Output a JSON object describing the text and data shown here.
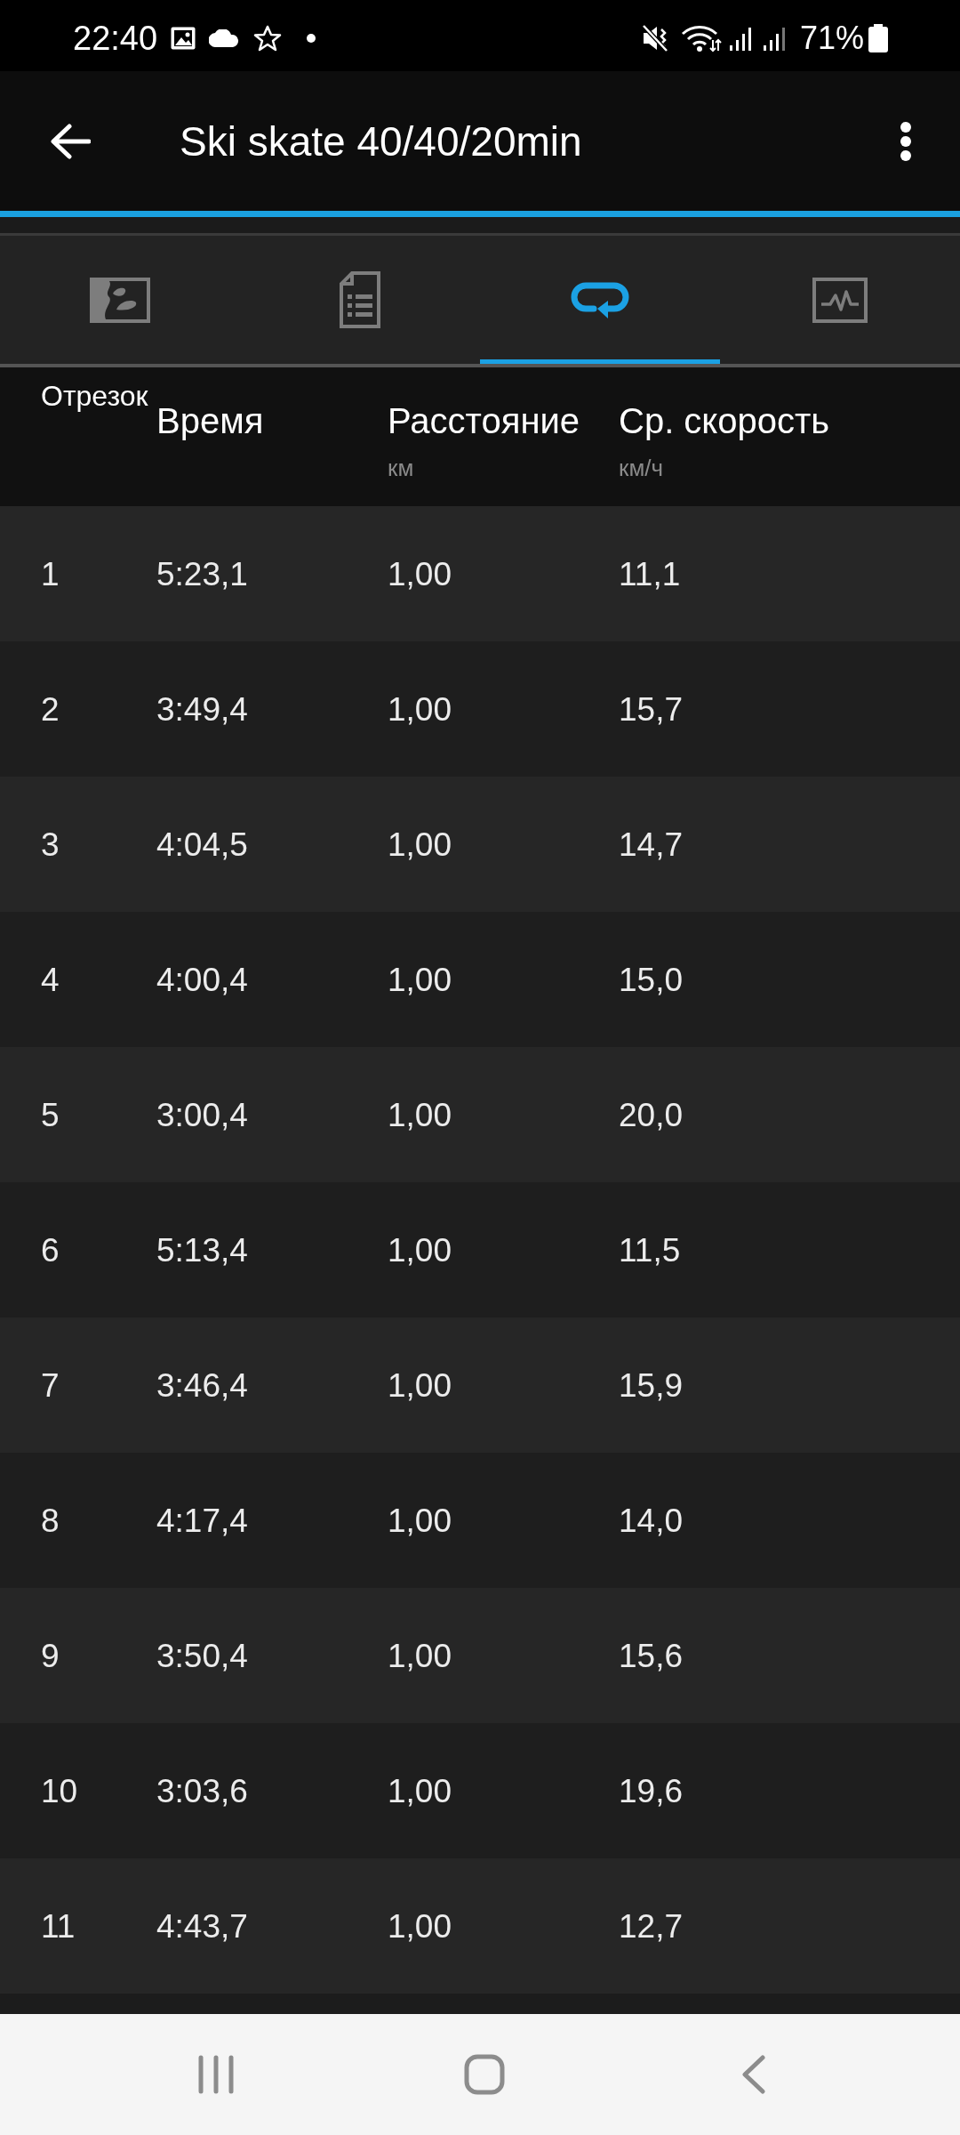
{
  "status_bar": {
    "time": "22:40",
    "battery_percent": "71%"
  },
  "app_bar": {
    "title": "Ski skate 40/40/20min"
  },
  "tabs": [
    {
      "kind": "map",
      "selected": false
    },
    {
      "kind": "details",
      "selected": false
    },
    {
      "kind": "laps",
      "selected": true
    },
    {
      "kind": "charts",
      "selected": false
    }
  ],
  "table": {
    "columns": [
      {
        "label": "Отрезок"
      },
      {
        "label": "Время"
      },
      {
        "label": "Расстояние",
        "unit": "км"
      },
      {
        "label": "Ср. скорость",
        "unit": "км/ч"
      }
    ],
    "rows": [
      [
        "1",
        "5:23,1",
        "1,00",
        "11,1"
      ],
      [
        "2",
        "3:49,4",
        "1,00",
        "15,7"
      ],
      [
        "3",
        "4:04,5",
        "1,00",
        "14,7"
      ],
      [
        "4",
        "4:00,4",
        "1,00",
        "15,0"
      ],
      [
        "5",
        "3:00,4",
        "1,00",
        "20,0"
      ],
      [
        "6",
        "5:13,4",
        "1,00",
        "11,5"
      ],
      [
        "7",
        "3:46,4",
        "1,00",
        "15,9"
      ],
      [
        "8",
        "4:17,4",
        "1,00",
        "14,0"
      ],
      [
        "9",
        "3:50,4",
        "1,00",
        "15,6"
      ],
      [
        "10",
        "3:03,6",
        "1,00",
        "19,6"
      ],
      [
        "11",
        "4:43,7",
        "1,00",
        "12,7"
      ]
    ]
  }
}
